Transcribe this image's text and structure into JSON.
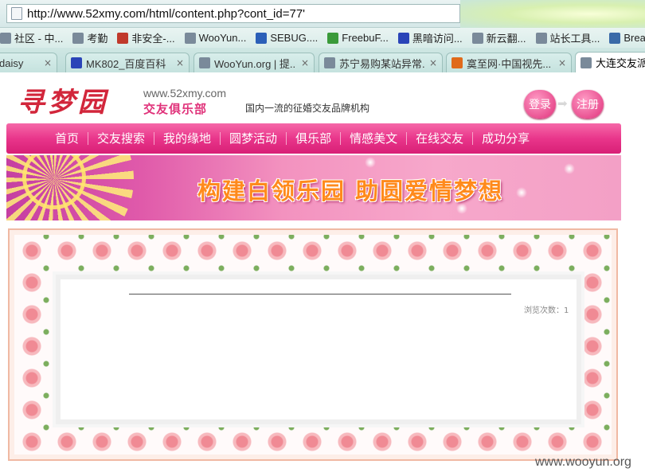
{
  "browser": {
    "url": "http://www.52xmy.com/html/content.php?cont_id=77'",
    "bookmarks": [
      {
        "label": "社区 - 中...",
        "icon": "page-icon",
        "color": "#7a8a9a"
      },
      {
        "label": "考勤",
        "icon": "page-icon",
        "color": "#7a8a9a"
      },
      {
        "label": "非安全-...",
        "icon": "no-icon",
        "color": "#c0392b"
      },
      {
        "label": "WooYun...",
        "icon": "page-icon",
        "color": "#7a8a9a"
      },
      {
        "label": "SEBUG....",
        "icon": "s-icon",
        "color": "#2b5fb8"
      },
      {
        "label": "FreebuF...",
        "icon": "leaf-icon",
        "color": "#3a9a3a"
      },
      {
        "label": "黑暗访问...",
        "icon": "paw-icon",
        "color": "#2a44b8"
      },
      {
        "label": "新云翻...",
        "icon": "page-icon",
        "color": "#7a8a9a"
      },
      {
        "label": "站长工具...",
        "icon": "page-icon",
        "color": "#7a8a9a"
      },
      {
        "label": "Bread's ...",
        "icon": "globe-icon",
        "color": "#3a6aa8"
      }
    ],
    "tabs": [
      {
        "label": "daisy",
        "icon": "none",
        "color": "#cfe7e4"
      },
      {
        "label": "MK802_百度百科",
        "icon": "paw-icon",
        "color": "#2a44b8"
      },
      {
        "label": "WooYun.org | 提...",
        "icon": "page-icon",
        "color": "#7a8a9a"
      },
      {
        "label": "苏宁易购某站异常...",
        "icon": "page-icon",
        "color": "#7a8a9a"
      },
      {
        "label": "寞至网·中国视先...",
        "icon": "han-icon",
        "color": "#e06a1a"
      },
      {
        "label": "大连交友派",
        "icon": "page-icon",
        "color": "#7a8a9a"
      }
    ],
    "close_glyph": "×"
  },
  "site": {
    "logo": "寻梦园",
    "domain": "www.52xmy.com",
    "club_name": "交友俱乐部",
    "slogan": "国内一流的征婚交友品牌机构",
    "login_label": "登录",
    "register_label": "注册",
    "arrow_glyph": "➡",
    "nav": [
      "首页",
      "交友搜索",
      "我的缘地",
      "圆梦活动",
      "俱乐部",
      "情感美文",
      "在线交友",
      "成功分享"
    ],
    "banner_text": "构建白领乐园  助圆爱情梦想",
    "views_label": "浏览次数：1"
  },
  "watermark": "www.wooyun.org"
}
